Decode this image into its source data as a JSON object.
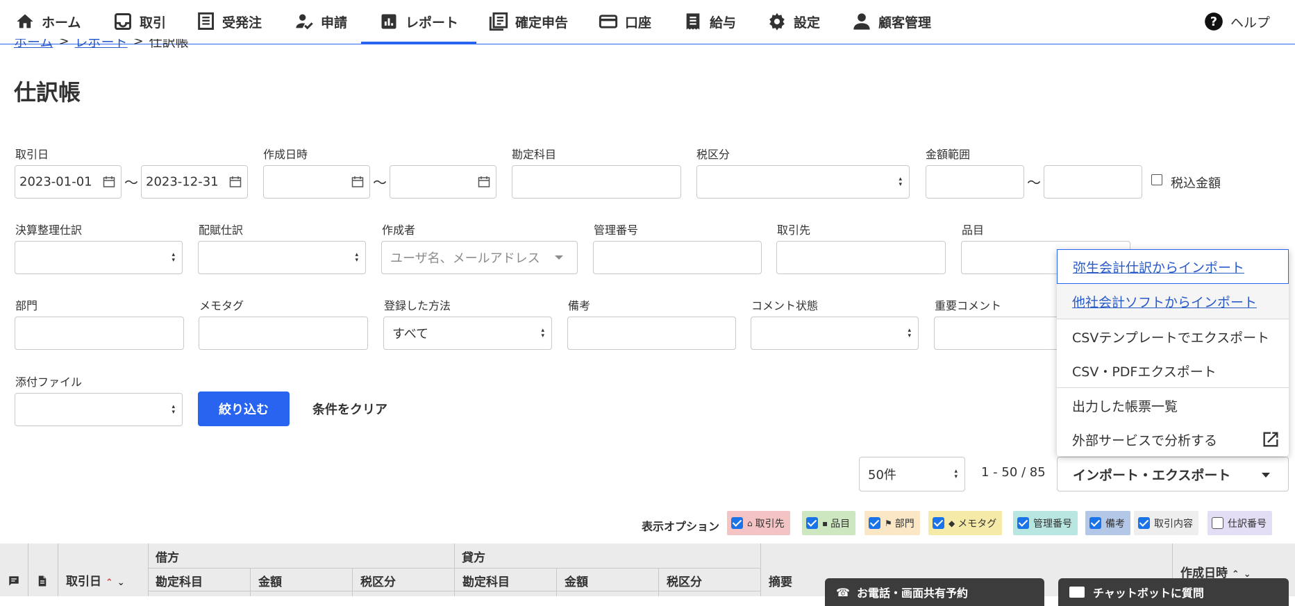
{
  "nav": {
    "items": [
      {
        "label": "ホーム",
        "icon": "home-icon"
      },
      {
        "label": "取引",
        "icon": "transaction-icon"
      },
      {
        "label": "受発注",
        "icon": "orders-icon"
      },
      {
        "label": "申請",
        "icon": "approval-icon"
      },
      {
        "label": "レポート",
        "icon": "report-icon",
        "active": true
      },
      {
        "label": "確定申告",
        "icon": "tax-return-icon"
      },
      {
        "label": "口座",
        "icon": "account-icon"
      },
      {
        "label": "給与",
        "icon": "payroll-icon"
      },
      {
        "label": "設定",
        "icon": "gear-icon"
      },
      {
        "label": "顧客管理",
        "icon": "customer-icon"
      }
    ],
    "help": "ヘルプ"
  },
  "breadcrumb": {
    "home": "ホーム",
    "report": "レポート",
    "current": "仕訳帳"
  },
  "page_title": "仕訳帳",
  "filters": {
    "transaction_date": {
      "label": "取引日",
      "from": "2023-01-01",
      "to": "2023-12-31"
    },
    "created_at": {
      "label": "作成日時"
    },
    "account_item": {
      "label": "勘定科目"
    },
    "tax_category": {
      "label": "税区分"
    },
    "amount_range": {
      "label": "金額範囲",
      "tax_included_label": "税込金額"
    },
    "closing_entry": {
      "label": "決算整理仕訳"
    },
    "allocation_entry": {
      "label": "配賦仕訳"
    },
    "creator": {
      "label": "作成者",
      "placeholder": "ユーザ名、メールアドレス"
    },
    "management_number": {
      "label": "管理番号"
    },
    "partner": {
      "label": "取引先"
    },
    "item": {
      "label": "品目"
    },
    "section": {
      "label": "部門"
    },
    "memo_tag": {
      "label": "メモタグ"
    },
    "registration_method": {
      "label": "登録した方法",
      "value": "すべて"
    },
    "remarks": {
      "label": "備考"
    },
    "comment_status": {
      "label": "コメント状態"
    },
    "important_comment": {
      "label": "重要コメント"
    },
    "attachment": {
      "label": "添付ファイル"
    },
    "tilde": "～"
  },
  "actions": {
    "filter": "絞り込む",
    "clear": "条件をクリア"
  },
  "menu": {
    "items": [
      "弥生会計仕訳からインポート",
      "他社会計ソフトからインポート",
      "CSVテンプレートでエクスポート",
      "CSV・PDFエクスポート",
      "出力した帳票一覧",
      "外部サービスで分析する"
    ]
  },
  "pagination": {
    "per_page": "50件",
    "range": "1 - 50 / 85",
    "import_export": "インポート・エクスポート"
  },
  "display_options": {
    "label": "表示オプション",
    "chips": [
      {
        "label": "取引先",
        "checked": true,
        "color": "#f4c3c3",
        "glyph": "⌂"
      },
      {
        "label": "品目",
        "checked": true,
        "color": "#cde8c0",
        "glyph": "▪"
      },
      {
        "label": "部門",
        "checked": true,
        "color": "#fbe7c6",
        "glyph": "⚑"
      },
      {
        "label": "メモタグ",
        "checked": true,
        "color": "#f6eaa8",
        "glyph": "◆"
      },
      {
        "label": "管理番号",
        "checked": true,
        "color": "#b8e6e1",
        "glyph": ""
      },
      {
        "label": "備考",
        "checked": true,
        "color": "#b3c7e6",
        "glyph": ""
      },
      {
        "label": "取引内容",
        "checked": true,
        "color": "#eeeeee",
        "glyph": ""
      },
      {
        "label": "仕訳番号",
        "checked": false,
        "color": "#e3ddf5",
        "glyph": ""
      }
    ]
  },
  "table": {
    "transaction_date": "取引日",
    "debit": "借方",
    "credit": "貸方",
    "account_item": "勘定科目",
    "amount": "金額",
    "tax_category": "税区分",
    "description": "摘要",
    "created_at": "作成日時"
  },
  "floating": {
    "phone": "お電話・画面共有予約",
    "chatbot": "チャットボットに質問"
  }
}
